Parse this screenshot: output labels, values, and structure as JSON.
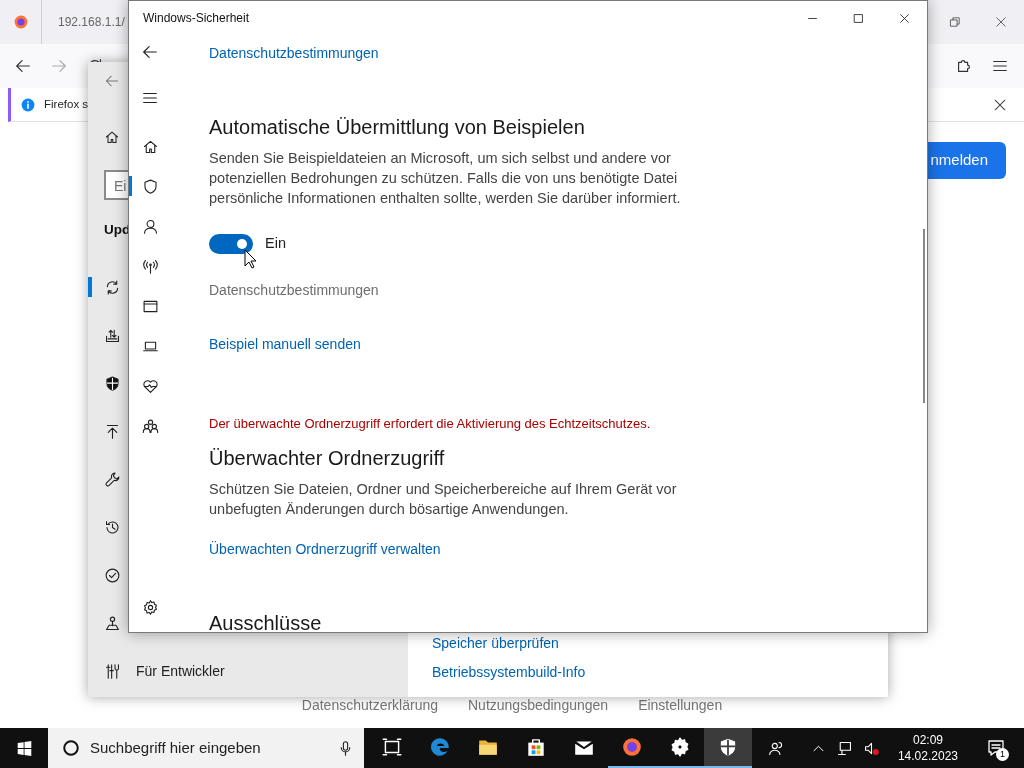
{
  "browser": {
    "tab_title": "192.168.1.1/",
    "notification": "Firefox s",
    "signin_button": "nmelden",
    "footer_links": [
      "Datenschutzerklärung",
      "Nutzungsbedingungen",
      "Einstellungen"
    ]
  },
  "settings_window": {
    "search_value": "Ei",
    "heading": "Upd",
    "nav": [
      {
        "kind": "sync",
        "selected": true
      },
      {
        "kind": "delivery",
        "selected": false
      },
      {
        "kind": "shieldfill",
        "selected": false
      },
      {
        "kind": "uparrow",
        "selected": false
      },
      {
        "kind": "wrench",
        "selected": false
      },
      {
        "kind": "history",
        "selected": false
      },
      {
        "kind": "check",
        "selected": false
      },
      {
        "kind": "locate",
        "selected": false
      },
      {
        "kind": "developer",
        "label": "Für Entwickler",
        "selected": false
      }
    ],
    "links": [
      "Speicher überprüfen",
      "Betriebssystembuild-Info"
    ]
  },
  "security_window": {
    "title": "Windows-Sicherheit",
    "nav": [
      {
        "kind": "home",
        "selected": false
      },
      {
        "kind": "shield",
        "selected": true
      },
      {
        "kind": "person",
        "selected": false
      },
      {
        "kind": "antenna",
        "selected": false
      },
      {
        "kind": "window",
        "selected": false
      },
      {
        "kind": "laptop",
        "selected": false
      },
      {
        "kind": "heart",
        "selected": false
      },
      {
        "kind": "family",
        "selected": false
      }
    ],
    "content": [
      {
        "kind": "link",
        "text": "Datenschutzbestimmungen",
        "disabled": false
      },
      {
        "kind": "heading",
        "text": "Automatische Übermittlung von Beispielen"
      },
      {
        "kind": "paragraph",
        "text": "Senden Sie Beispieldateien an Microsoft, um sich selbst und andere vor potenziellen Bedrohungen zu schützen. Falls die von uns benötigte Datei persönliche Informationen enthalten sollte, werden Sie darüber informiert."
      },
      {
        "kind": "toggle",
        "on": true,
        "label": "Ein"
      },
      {
        "kind": "link",
        "text": "Datenschutzbestimmungen",
        "disabled": true
      },
      {
        "kind": "link",
        "text": "Beispiel manuell senden",
        "disabled": false
      },
      {
        "kind": "warning",
        "text": "Der überwachte Ordnerzugriff erfordert die Aktivierung des Echtzeitschutzes."
      },
      {
        "kind": "heading",
        "text": "Überwachter Ordnerzugriff"
      },
      {
        "kind": "paragraph",
        "text": "Schützen Sie Dateien, Ordner und Speicherbereiche auf Ihrem Gerät vor unbefugten Änderungen durch bösartige Anwendungen."
      },
      {
        "kind": "link",
        "text": "Überwachten Ordnerzugriff verwalten",
        "disabled": false
      },
      {
        "kind": "heading",
        "text": "Ausschlüsse"
      }
    ]
  },
  "taskbar": {
    "search_placeholder": "Suchbegriff hier eingeben",
    "apps": [
      {
        "kind": "taskview",
        "running": false,
        "active": false
      },
      {
        "kind": "edge",
        "running": false,
        "active": false
      },
      {
        "kind": "folder",
        "running": false,
        "active": false
      },
      {
        "kind": "store",
        "running": false,
        "active": false
      },
      {
        "kind": "mail",
        "running": false,
        "active": false
      },
      {
        "kind": "firefox",
        "running": true,
        "active": false
      },
      {
        "kind": "gearwhite",
        "running": true,
        "active": false
      },
      {
        "kind": "shieldwhite",
        "running": true,
        "active": true
      }
    ],
    "time": "02:09",
    "date": "14.02.2023",
    "notification_count": "1"
  }
}
